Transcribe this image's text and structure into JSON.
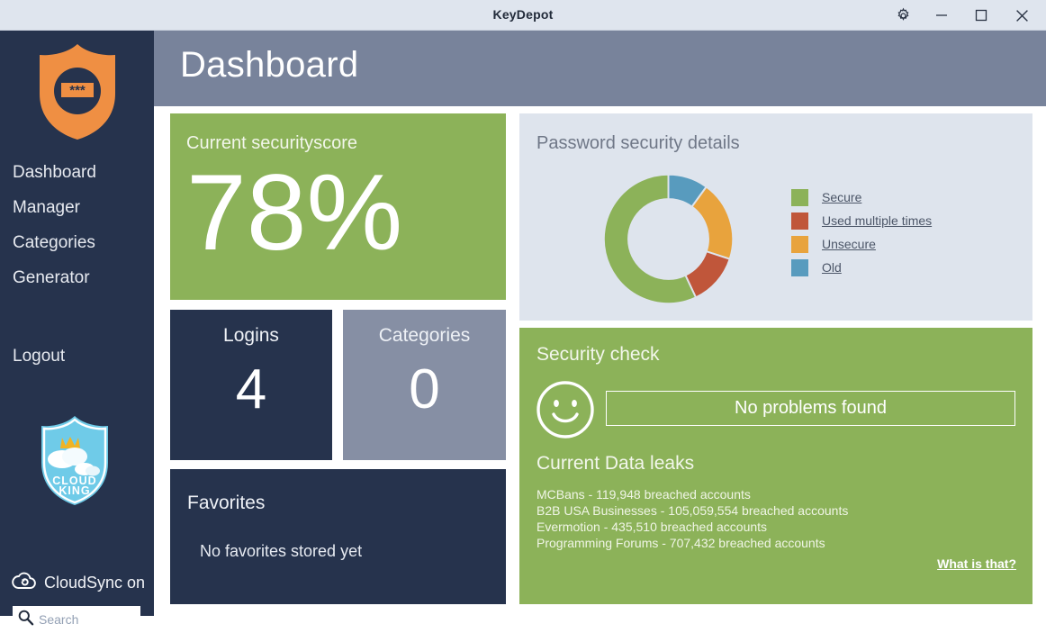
{
  "window": {
    "title": "KeyDepot",
    "controls": [
      {
        "name": "settings-gear",
        "glyph": "gear"
      },
      {
        "name": "minimize",
        "glyph": "minus"
      },
      {
        "name": "maximize",
        "glyph": "square"
      },
      {
        "name": "close",
        "glyph": "cross"
      }
    ]
  },
  "sidebar": {
    "logo_alt": "keydepot-shield-logo",
    "items": [
      {
        "label": "Dashboard"
      },
      {
        "label": "Manager"
      },
      {
        "label": "Categories"
      },
      {
        "label": "Generator"
      }
    ],
    "logout_label": "Logout",
    "cloud_logo_text_top": "CLOUD",
    "cloud_logo_text_bottom": "KING",
    "cloudsync_label": "CloudSync on",
    "search": {
      "placeholder": "Search",
      "value": ""
    }
  },
  "header": {
    "title": "Dashboard"
  },
  "score_card": {
    "title": "Current securityscore",
    "value": "78%",
    "color": "#8cb259"
  },
  "tiles": [
    {
      "name": "logins",
      "title": "Logins",
      "value": "4",
      "color": "#26334d"
    },
    {
      "name": "categories",
      "title": "Categories",
      "value": "0",
      "color": "#868fa4"
    }
  ],
  "favorites": {
    "title": "Favorites",
    "empty_text": "No favorites stored yet"
  },
  "password_security": {
    "title": "Password security details"
  },
  "security_check": {
    "title": "Security check",
    "status_text": "No problems found",
    "leaks_title": "Current Data leaks",
    "leaks": [
      "MCBans - 119,948 breached accounts",
      "B2B USA Businesses - 105,059,554 breached accounts",
      "Evermotion - 435,510 breached accounts",
      "Programming Forums - 707,432 breached accounts"
    ],
    "what_is_that": "What is that?"
  },
  "chart_data": {
    "type": "pie",
    "title": "Password security details",
    "variant": "donut",
    "legend_position": "right",
    "categories": [
      "Secure",
      "Used multiple times",
      "Unsecure",
      "Old"
    ],
    "values": [
      57,
      13,
      20,
      10
    ],
    "unit": "percent",
    "colors": [
      "#8cb259",
      "#c0563a",
      "#e8a33d",
      "#589bbe"
    ],
    "start_angle_deg": 0,
    "direction": "clockwise",
    "inner_radius_ratio": 0.62
  }
}
